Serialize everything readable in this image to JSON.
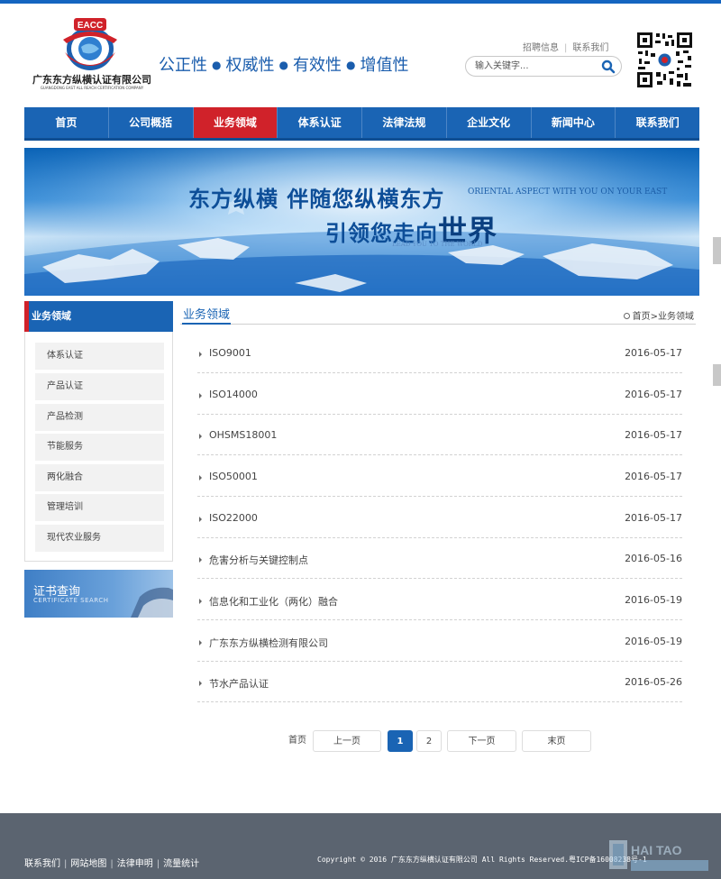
{
  "logo": {
    "badge_text": "EACC",
    "company_cn": "广东东方纵横认证有限公司",
    "company_en": "GUANGDONG EAST ALL REACH CERTIFICATION COMPANY"
  },
  "slogan": [
    "公正性",
    "权威性",
    "有效性",
    "增值性"
  ],
  "top_links": [
    "招聘信息",
    "联系我们"
  ],
  "search": {
    "placeholder": "输入关键字..."
  },
  "nav": {
    "items": [
      "首页",
      "公司概括",
      "业务领域",
      "体系认证",
      "法律法规",
      "企业文化",
      "新闻中心",
      "联系我们"
    ],
    "active_index": 2
  },
  "banner": {
    "line1": "东方纵横  伴随您纵横东方",
    "line1_en": "ORIENTAL ASPECT WITH YOU ON YOUR EAST",
    "line2_prefix": "引领您走向",
    "line2_big": "世界",
    "line2_en": "LEAD YOU TO THE WORLD"
  },
  "sidebar": {
    "title": "业务领域",
    "items": [
      "体系认证",
      "产品认证",
      "产品检测",
      "节能服务",
      "两化融合",
      "管理培训",
      "现代农业服务"
    ],
    "cert_title": "证书查询",
    "cert_subtitle": "CERTIFICATE SEARCH"
  },
  "main": {
    "title": "业务领域",
    "breadcrumb": "首页>业务领域",
    "list": [
      {
        "title": "ISO9001",
        "date": "2016-05-17"
      },
      {
        "title": "ISO14000",
        "date": "2016-05-17"
      },
      {
        "title": "OHSMS18001",
        "date": "2016-05-17"
      },
      {
        "title": "ISO50001",
        "date": "2016-05-17"
      },
      {
        "title": "ISO22000",
        "date": "2016-05-17"
      },
      {
        "title": "危害分析与关键控制点",
        "date": "2016-05-16"
      },
      {
        "title": "信息化和工业化（两化）融合",
        "date": "2016-05-19"
      },
      {
        "title": "广东东方纵横检测有限公司",
        "date": "2016-05-19"
      },
      {
        "title": "节水产品认证",
        "date": "2016-05-26"
      }
    ]
  },
  "pagination": {
    "first": "首页",
    "prev": "上一页",
    "pages": [
      "1",
      "2"
    ],
    "current": "1",
    "next": "下一页",
    "last": "末页"
  },
  "footer": {
    "links": [
      "联系我们",
      "网站地图",
      "法律申明",
      "流量统计"
    ],
    "copyright": "Copyright © 2016 广东东方纵横认证有限公司 All Rights Reserved.粤ICP备16008238号-1",
    "watermark": "HAI TAO"
  },
  "colors": {
    "nav_blue": "#1a64b4",
    "active_red": "#d0222a",
    "footer_gray": "#5b6470"
  }
}
